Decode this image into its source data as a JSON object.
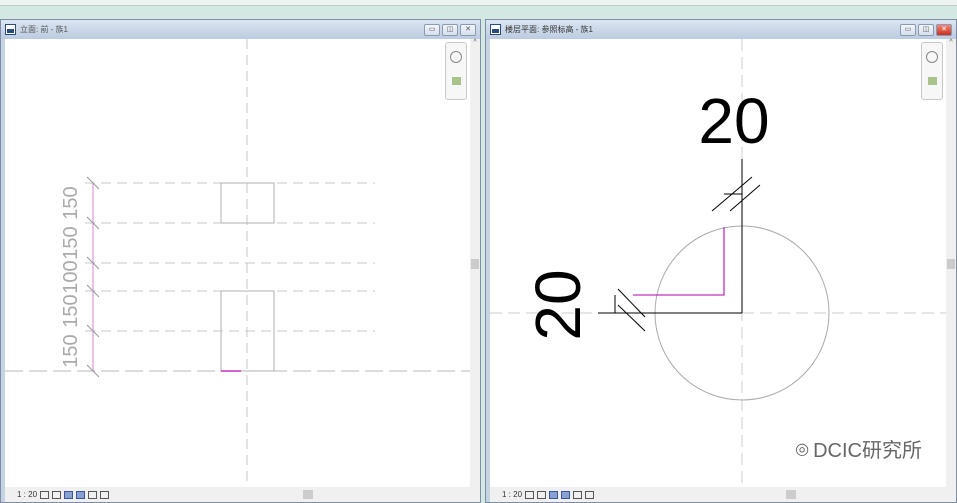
{
  "left_view": {
    "title": "立面: 前 - 族1",
    "scale": "1 : 20",
    "dimensions": [
      "150",
      "150",
      "100",
      "150",
      "150"
    ]
  },
  "right_view": {
    "title": "楼层平面: 参照标高 - 族1",
    "scale": "1 : 20",
    "dim_horizontal": "20",
    "dim_vertical": "20"
  },
  "window_buttons": {
    "minimize": "▭",
    "restore": "◫",
    "close": "✕"
  },
  "watermark": "DCIC研究所",
  "colors": {
    "accent": "#c030c0",
    "close": "#c9301c"
  }
}
